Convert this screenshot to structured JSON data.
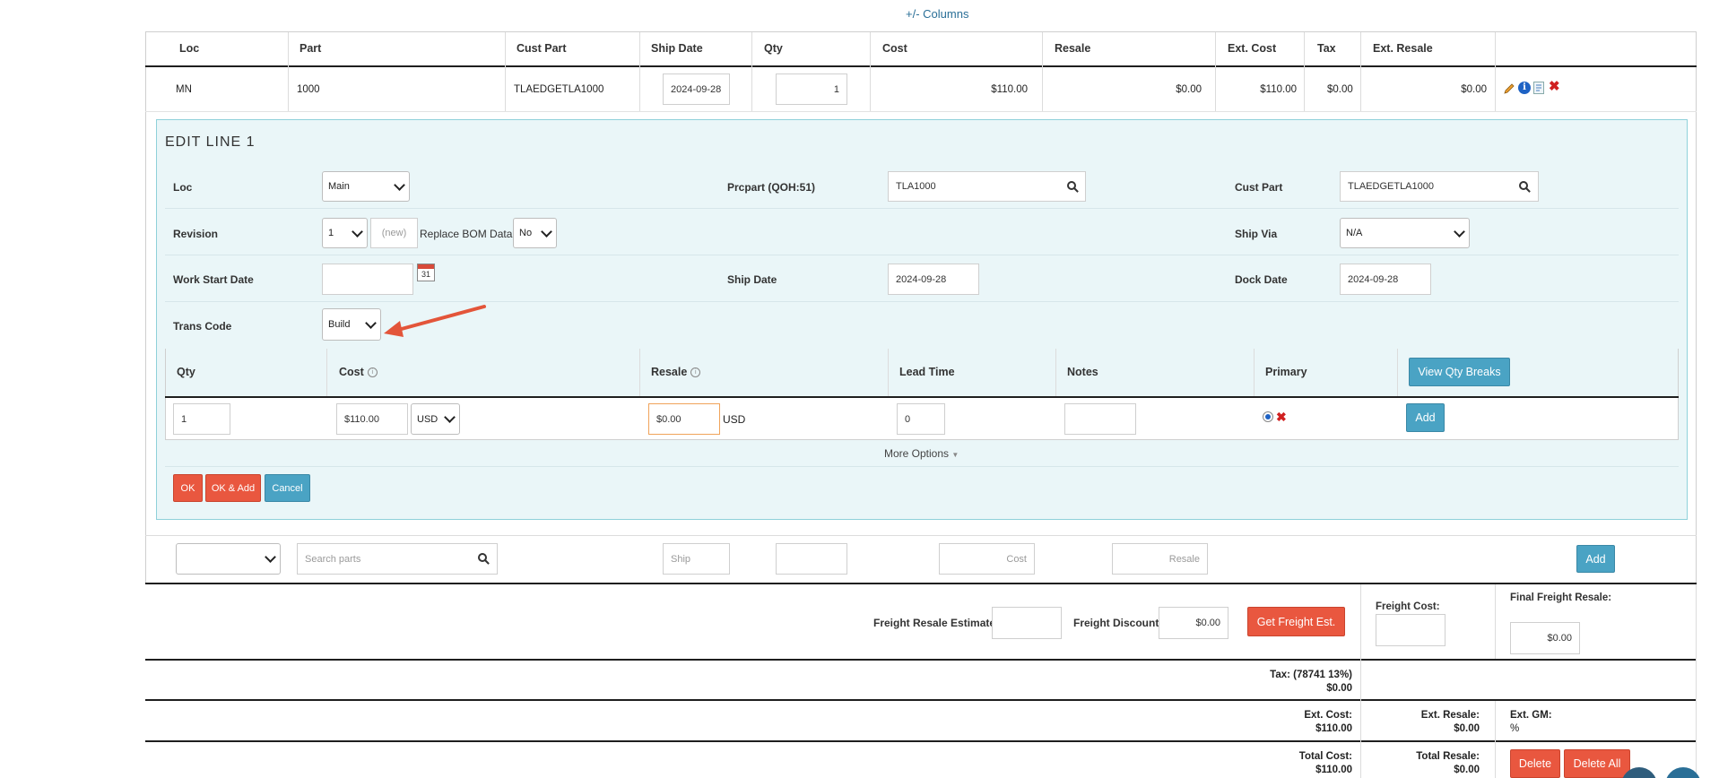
{
  "top_link": "+/- Columns",
  "grid": {
    "headers": [
      "Loc",
      "Part",
      "Cust Part",
      "Ship Date",
      "Qty",
      "Cost",
      "Resale",
      "Ext. Cost",
      "Tax",
      "Ext. Resale"
    ],
    "row": {
      "loc": "MN",
      "part": "1000",
      "cust_part": "TLAEDGETLA1000",
      "ship_date": "2024-09-28",
      "qty": "1",
      "cost": "$110.00",
      "resale": "$0.00",
      "ext_cost": "$110.00",
      "tax": "$0.00",
      "ext_resale": "$0.00"
    }
  },
  "edit": {
    "title": "EDIT LINE 1",
    "loc_label": "Loc",
    "loc_value": "Main",
    "prcpart_label": "Prcpart (QOH:51)",
    "prcpart_value": "TLA1000",
    "custpart_label": "Cust Part",
    "custpart_value": "TLAEDGETLA1000",
    "revision_label": "Revision",
    "revision_value": "1",
    "revision_new": "(new)",
    "replace_bom_label": "Replace BOM Data?",
    "replace_bom_value": "No",
    "shipvia_label": "Ship Via",
    "shipvia_value": "N/A",
    "workstart_label": "Work Start Date",
    "workstart_value": "",
    "shipdate_label": "Ship Date",
    "shipdate_value": "2024-09-28",
    "dockdate_label": "Dock Date",
    "dockdate_value": "2024-09-28",
    "transcode_label": "Trans Code",
    "transcode_value": "Build",
    "calendar_day": "31",
    "sub_headers": {
      "qty": "Qty",
      "cost": "Cost",
      "resale": "Resale",
      "lead": "Lead Time",
      "notes": "Notes",
      "primary": "Primary"
    },
    "view_qty_breaks": "View Qty Breaks",
    "sub_row": {
      "qty": "1",
      "cost": "$110.00",
      "currency": "USD",
      "resale": "$0.00",
      "resale_currency": "USD",
      "lead": "0",
      "notes": ""
    },
    "add_label": "Add",
    "more_options": "More Options",
    "ok": "OK",
    "ok_add": "OK & Add",
    "cancel": "Cancel"
  },
  "new_line": {
    "search_placeholder": "Search parts",
    "ship_placeholder": "Ship",
    "cost_placeholder": "Cost",
    "resale_placeholder": "Resale",
    "add_label": "Add"
  },
  "freight": {
    "resale_est_label": "Freight Resale Estimate:",
    "discount_label": "Freight Discount:",
    "discount_value": "$0.00",
    "get_est_label": "Get Freight Est.",
    "cost_label": "Freight Cost:",
    "final_label": "Final Freight Resale:",
    "final_value": "$0.00"
  },
  "totals": {
    "tax_label": "Tax: (78741 13%)",
    "tax_value": "$0.00",
    "ext_cost_label": "Ext. Cost:",
    "ext_cost_value": "$110.00",
    "ext_resale_label": "Ext. Resale:",
    "ext_resale_value": "$0.00",
    "ext_gm_label": "Ext. GM:",
    "ext_gm_value": "%",
    "total_cost_label": "Total Cost:",
    "total_cost_value": "$110.00",
    "total_resale_label": "Total Resale:",
    "total_resale_value": "$0.00",
    "delete_label": "Delete",
    "delete_all_label": "Delete All"
  },
  "colors": {
    "link": "#2a6f97",
    "panel_bg": "#eaf6f8",
    "red_button": "#e9573f",
    "blue_button": "#4aa3c4",
    "annotation_arrow": "#e3553a"
  }
}
